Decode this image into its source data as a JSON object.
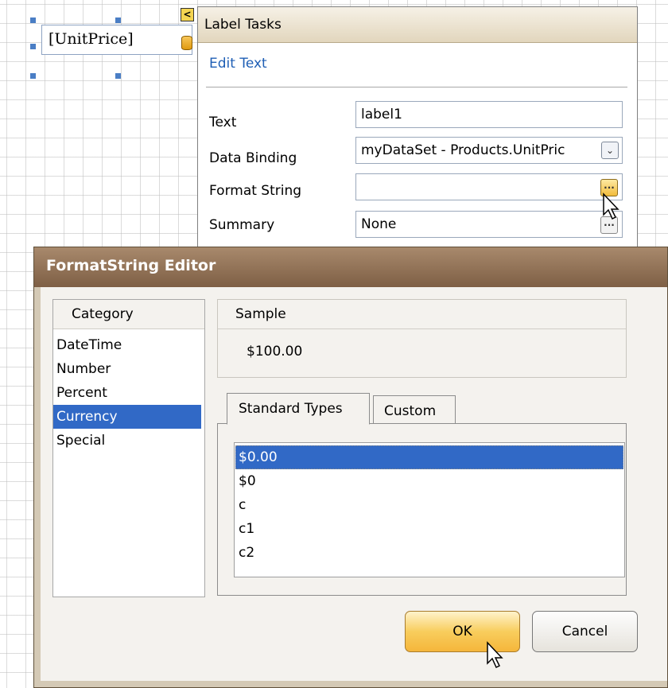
{
  "designer": {
    "label_text": "[UnitPrice]",
    "smart_tag_glyph": "<"
  },
  "label_tasks": {
    "title": "Label Tasks",
    "edit_text_link": "Edit Text",
    "rows": {
      "text": {
        "label": "Text",
        "value": "label1"
      },
      "data_binding": {
        "label": "Data Binding",
        "value": "myDataSet - Products.UnitPric",
        "button_glyph": "⌄"
      },
      "format_string": {
        "label": "Format String",
        "value": "",
        "button_glyph": "..."
      },
      "summary": {
        "label": "Summary",
        "value": "None",
        "button_glyph": "..."
      }
    }
  },
  "dialog": {
    "title": "FormatString Editor",
    "category_header": "Category",
    "categories": [
      "DateTime",
      "Number",
      "Percent",
      "Currency",
      "Special"
    ],
    "selected_category": "Currency",
    "sample_header": "Sample",
    "sample_value": "$100.00",
    "tabs": [
      "Standard Types",
      "Custom"
    ],
    "active_tab": "Standard Types",
    "types": [
      "$0.00",
      "$0",
      "c",
      "c1",
      "c2"
    ],
    "selected_type": "$0.00",
    "ok_label": "OK",
    "cancel_label": "Cancel"
  },
  "colors": {
    "selection": "#3169c6",
    "title_bar": "#8e6f54",
    "link": "#1f5fb5",
    "ok_button": "#f8cd5d"
  }
}
